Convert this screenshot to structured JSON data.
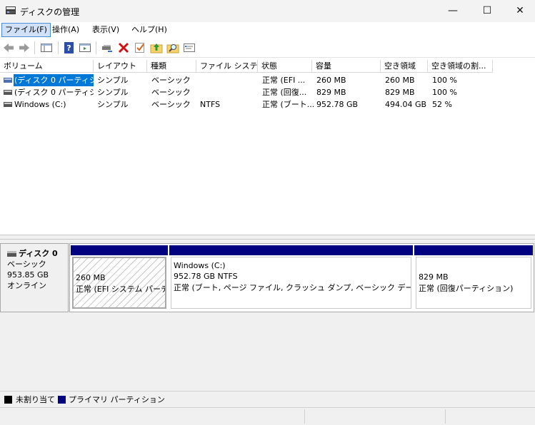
{
  "window": {
    "title": "ディスクの管理",
    "controls": {
      "minimize": "—",
      "maximize": "☐",
      "close": "✕"
    }
  },
  "menu": [
    {
      "label": "ファイル(F)"
    },
    {
      "label": "操作(A)"
    },
    {
      "label": "表示(V)"
    },
    {
      "label": "ヘルプ(H)"
    }
  ],
  "toolbar": {
    "icons": [
      "back-icon",
      "forward-icon",
      "console-tree-icon",
      "help-icon",
      "action-pane-icon",
      "connect-disk-icon",
      "delete-icon",
      "check-icon",
      "up-folder-icon",
      "search-folder-icon",
      "properties-icon"
    ]
  },
  "volume_list": {
    "columns": [
      "ボリューム",
      "レイアウト",
      "種類",
      "ファイル システム",
      "状態",
      "容量",
      "空き領域",
      "空き領域の割..."
    ],
    "rows": [
      {
        "volume": "(ディスク 0 パーティシ...",
        "layout": "シンプル",
        "type": "ベーシック",
        "fs": "",
        "status": "正常 (EFI ...",
        "capacity": "260 MB",
        "free": "260 MB",
        "percent": "100 %"
      },
      {
        "volume": "(ディスク 0 パーティシ...",
        "layout": "シンプル",
        "type": "ベーシック",
        "fs": "",
        "status": "正常 (回復...",
        "capacity": "829 MB",
        "free": "829 MB",
        "percent": "100 %"
      },
      {
        "volume": "Windows (C:)",
        "layout": "シンプル",
        "type": "ベーシック",
        "fs": "NTFS",
        "status": "正常 (ブート...",
        "capacity": "952.78 GB",
        "free": "494.04 GB",
        "percent": "52 %"
      }
    ]
  },
  "disk": {
    "name": "ディスク 0",
    "type": "ベーシック",
    "size": "953.85 GB",
    "state": "オンライン",
    "partitions": [
      {
        "title": "",
        "size": "260 MB",
        "status": "正常 (EFI システム パーティション)"
      },
      {
        "title": "Windows (C:)",
        "size": "952.78 GB NTFS",
        "status": "正常 (ブート, ページ ファイル, クラッシュ ダンプ, ベーシック データ パーティション)"
      },
      {
        "title": "",
        "size": "829 MB",
        "status": "正常 (回復パーティション)"
      }
    ]
  },
  "legend": [
    {
      "label": "未割り当て",
      "color": "#000000"
    },
    {
      "label": "プライマリ パーティション",
      "color": "#000080"
    }
  ],
  "colors": {
    "selection": "#0078d7",
    "primary_partition": "#000080",
    "unallocated": "#000000"
  }
}
